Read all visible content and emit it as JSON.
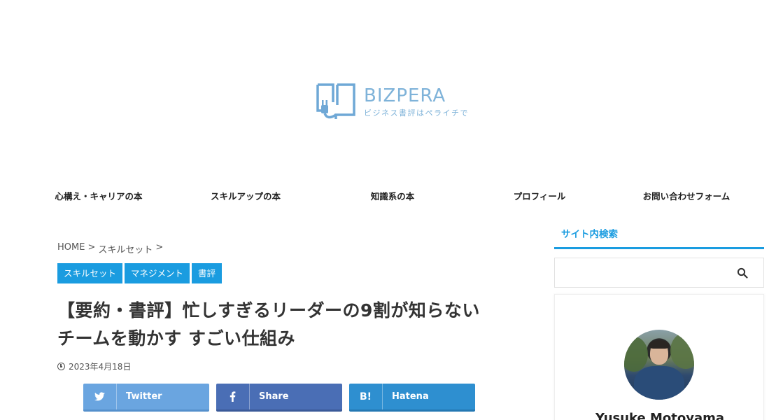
{
  "site": {
    "logo_title": "BIZPERA",
    "logo_subtitle": "ビジネス書評はペライチで",
    "logo_icon": "book-plug-icon",
    "accent_color": "#1a9ce0"
  },
  "nav": {
    "items": [
      {
        "label": "心構え・キャリアの本"
      },
      {
        "label": "スキルアップの本"
      },
      {
        "label": "知識系の本"
      },
      {
        "label": "プロフィール"
      },
      {
        "label": "お問い合わせフォーム"
      }
    ]
  },
  "breadcrumb": {
    "home": "HOME",
    "sep1": ">",
    "category": "スキルセット",
    "sep2": ">"
  },
  "tags": [
    {
      "label": "スキルセット"
    },
    {
      "label": "マネジメント"
    },
    {
      "label": "書評"
    }
  ],
  "post": {
    "title_line1": "【要約・書評】忙しすぎるリーダーの9割が知らない",
    "title_line2": "チームを動かす すごい仕組み",
    "date": "2023年4月18日",
    "date_icon": "clock-icon"
  },
  "share": {
    "twitter": {
      "label": "Twitter",
      "icon": "twitter-icon",
      "color": "#6aa5e0"
    },
    "facebook": {
      "label": "Share",
      "icon": "facebook-icon",
      "color": "#4a6eb5"
    },
    "hatena": {
      "label": "Hatena",
      "icon": "hatena-icon",
      "icon_text": "B!",
      "color": "#2e8fd0"
    }
  },
  "sidebar": {
    "search_heading": "サイト内検索",
    "search_placeholder": "",
    "search_icon": "search-icon",
    "profile_name": "Yusuke Motoyama"
  }
}
